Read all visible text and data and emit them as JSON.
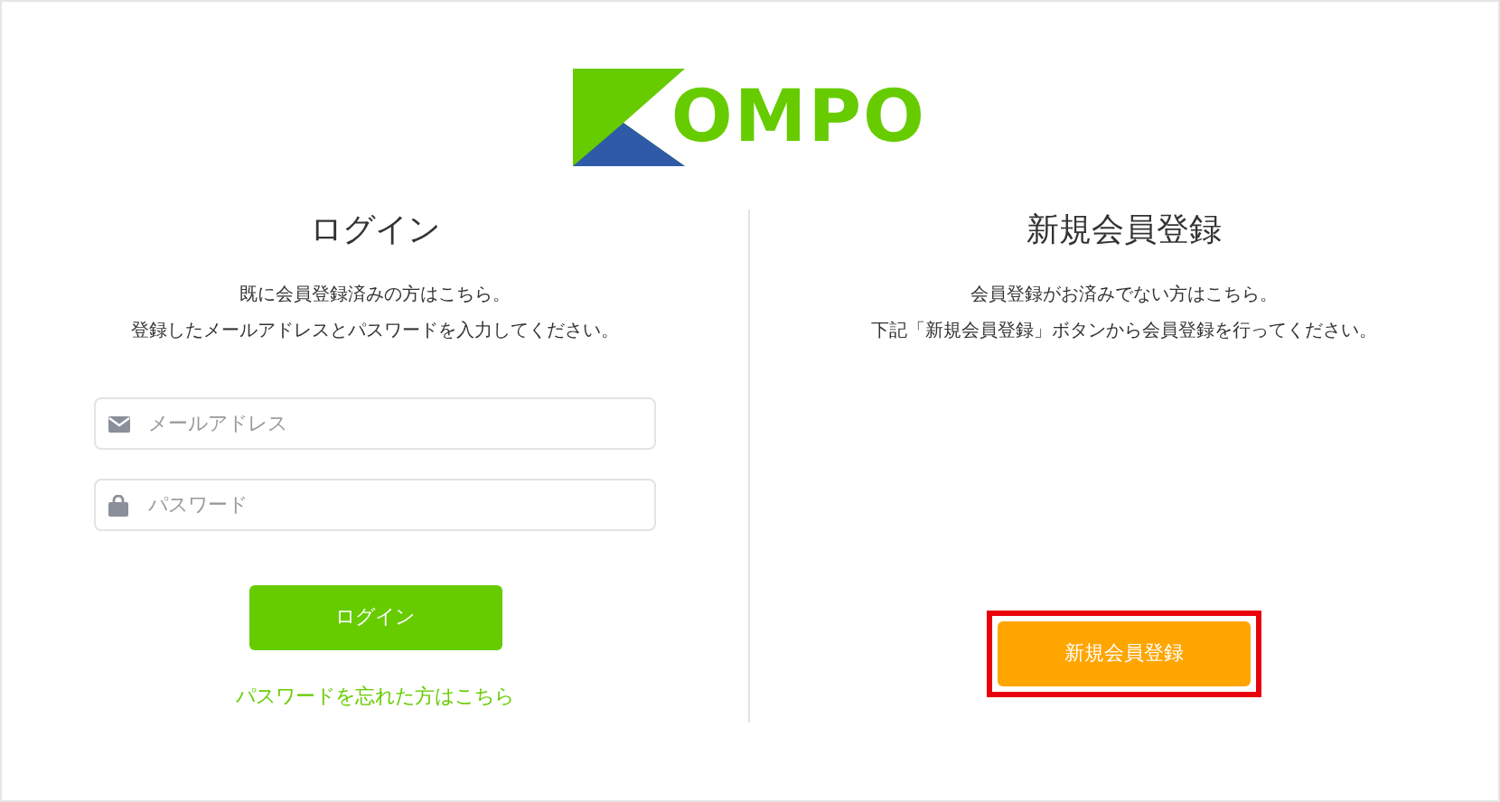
{
  "logo": {
    "text": "OMPO"
  },
  "login": {
    "title": "ログイン",
    "lines": [
      "既に会員登録済みの方はこちら。",
      "登録したメールアドレスとパスワードを入力してください。"
    ],
    "fields": [
      {
        "kind": "email",
        "placeholder": "メールアドレス"
      },
      {
        "kind": "password",
        "placeholder": "パスワード"
      }
    ],
    "button": "ログイン",
    "forgot_link": "パスワードを忘れた方はこちら"
  },
  "register": {
    "title": "新規会員登録",
    "lines": [
      "会員登録がお済みでない方はこちら。",
      "下記「新規会員登録」ボタンから会員登録を行ってください。"
    ],
    "button": "新規会員登録",
    "highlighted": true
  }
}
